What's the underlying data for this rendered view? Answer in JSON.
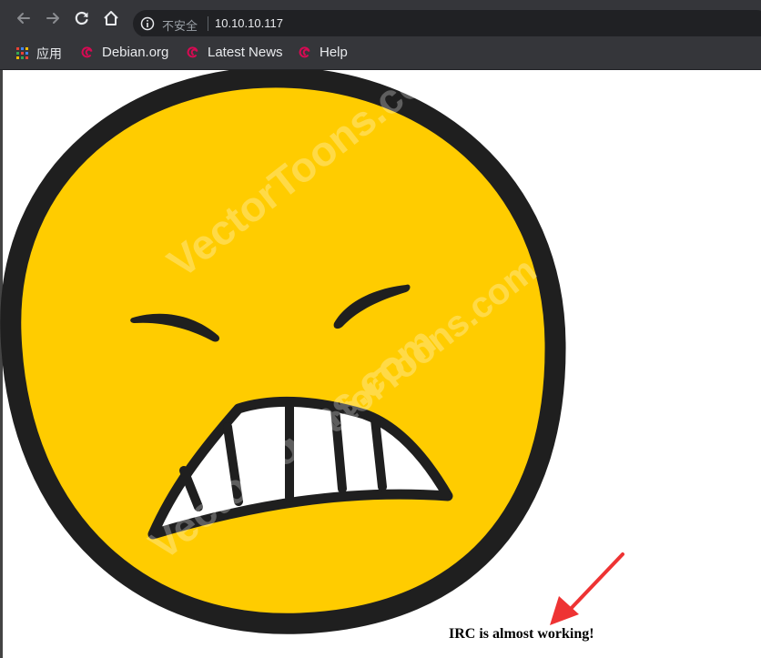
{
  "browser": {
    "security_label": "不安全",
    "url": "10.10.10.117",
    "nav_icons": [
      "back-arrow-icon",
      "forward-arrow-icon",
      "reload-icon",
      "home-icon",
      "info-icon"
    ]
  },
  "bookmarks": {
    "apps_label": "应用",
    "items": [
      {
        "label": "Debian.org",
        "icon": "debian-swirl-icon"
      },
      {
        "label": "Latest News",
        "icon": "debian-swirl-icon"
      },
      {
        "label": "Help",
        "icon": "debian-swirl-icon"
      }
    ]
  },
  "page": {
    "image": "angry-grimacing-emoji",
    "caption": "IRC is almost working!",
    "annotation": "red-arrow"
  },
  "colors": {
    "chrome_bg": "#35363a",
    "omnibox_bg": "#202124",
    "emoji_fill": "#ffcc00",
    "emoji_outline": "#1f1f1f",
    "debian_red": "#d70a53",
    "arrow_red": "#ee3333"
  }
}
